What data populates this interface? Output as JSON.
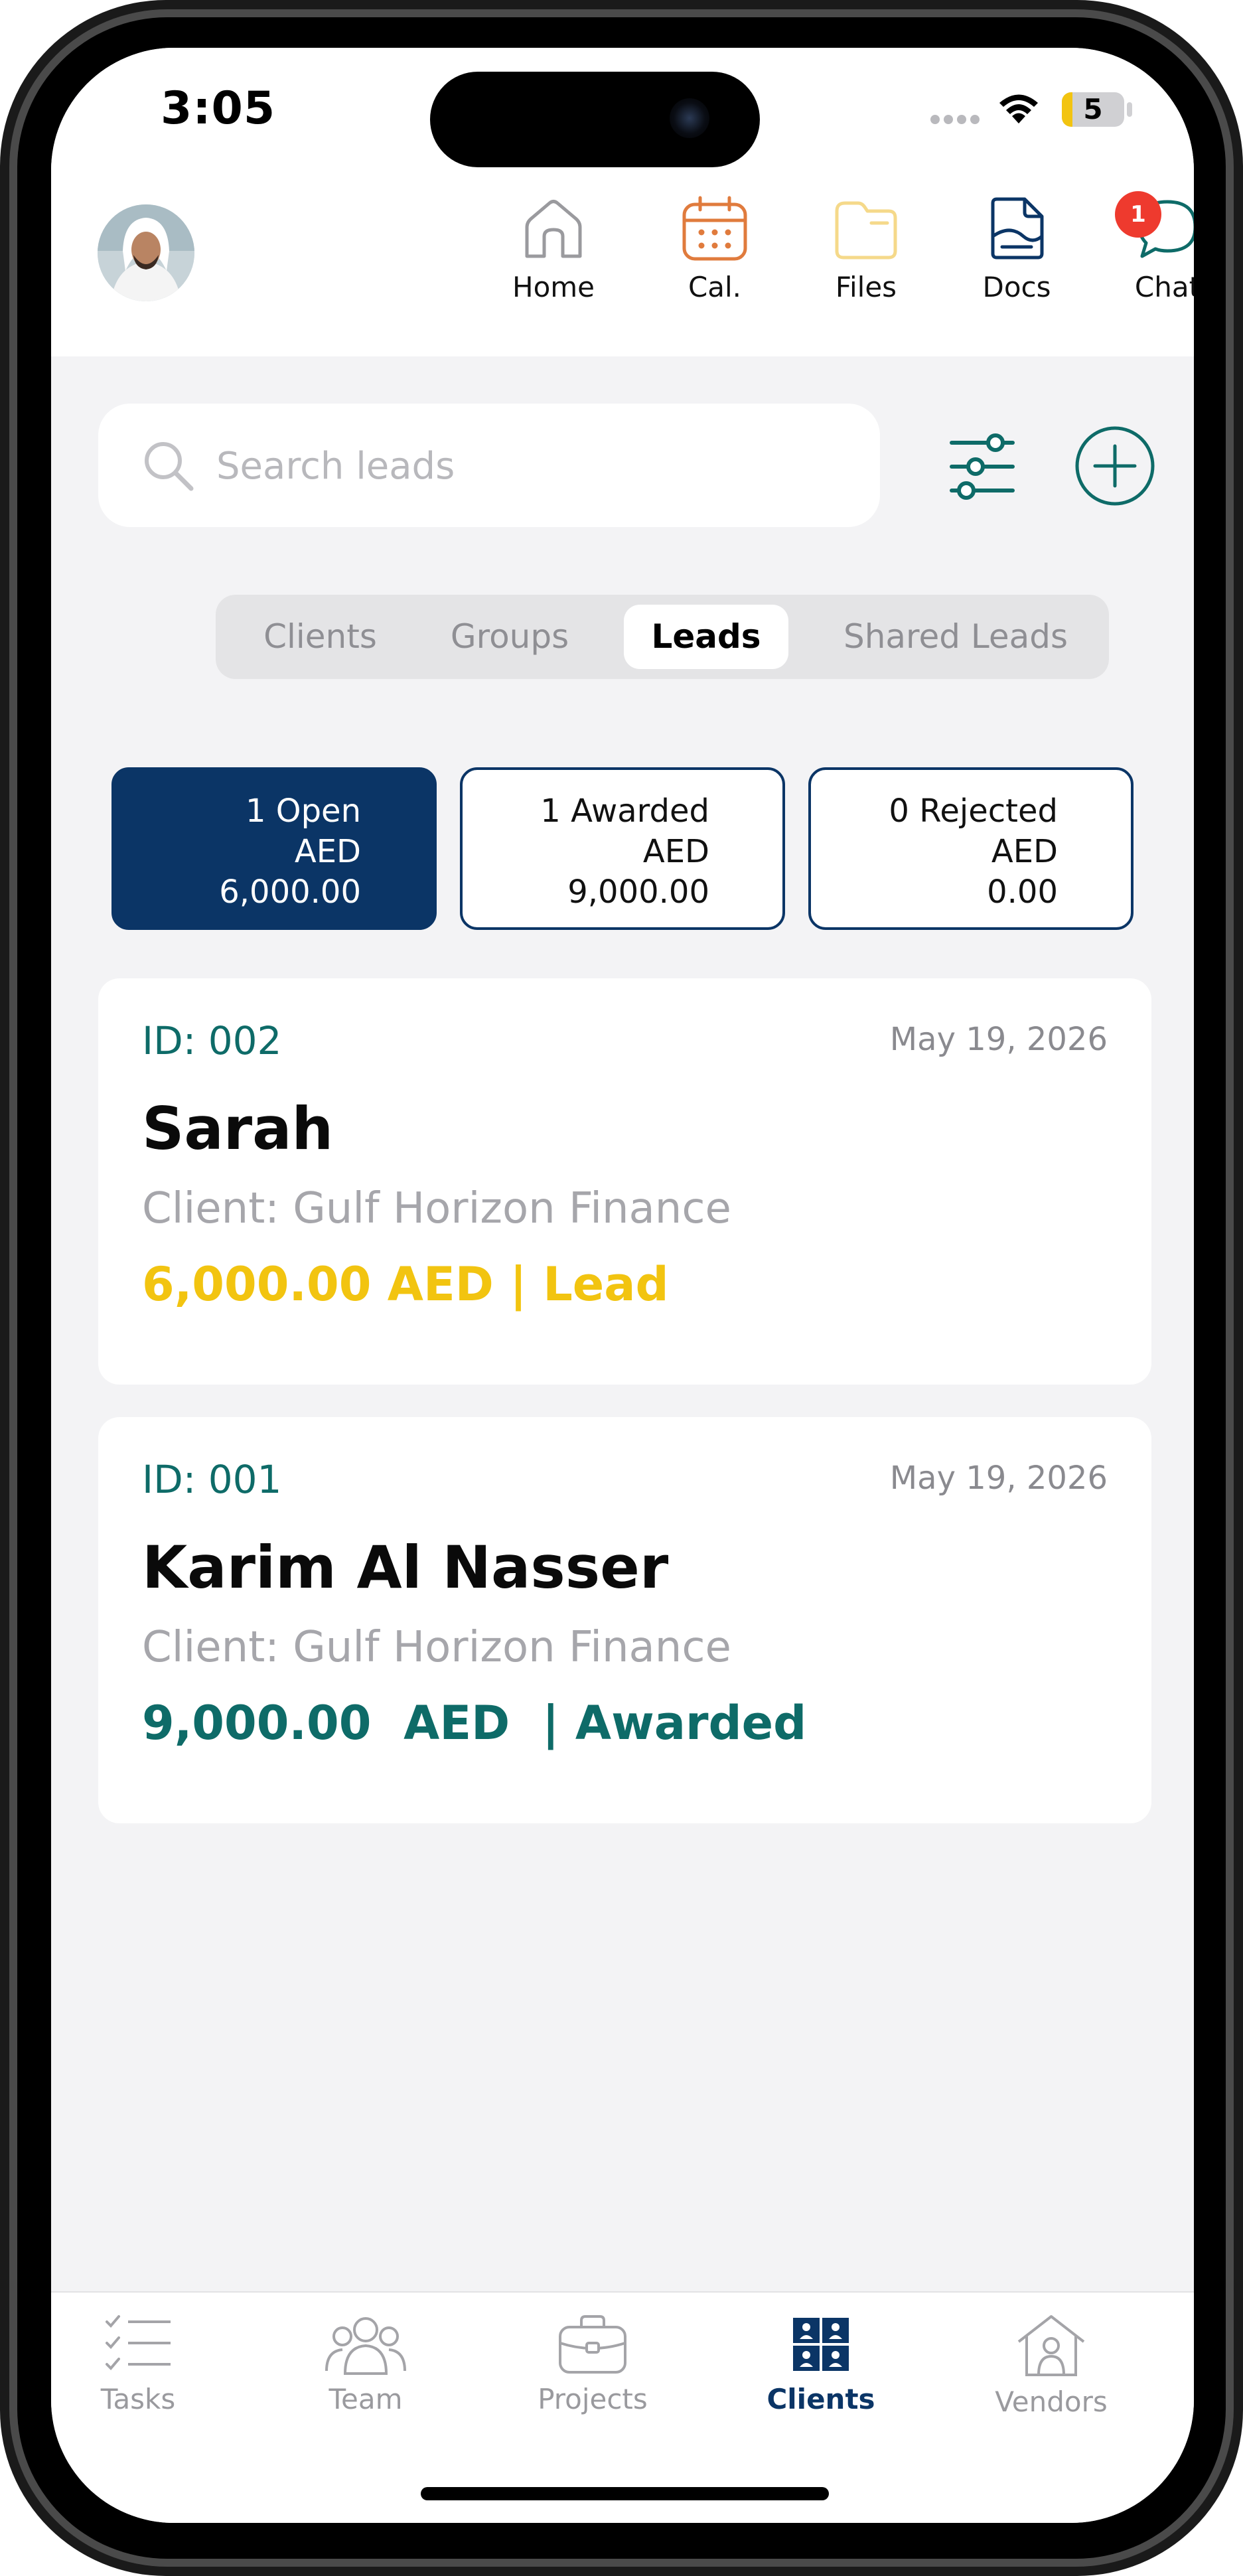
{
  "status_bar": {
    "time": "3:05",
    "battery": "5"
  },
  "header": {
    "nav": [
      {
        "label": "Home",
        "icon": "home-icon"
      },
      {
        "label": "Cal.",
        "icon": "calendar-icon"
      },
      {
        "label": "Files",
        "icon": "folder-icon"
      },
      {
        "label": "Docs",
        "icon": "document-icon"
      },
      {
        "label": "Chat",
        "icon": "chat-icon",
        "badge": "1"
      }
    ]
  },
  "search": {
    "placeholder": "Search leads",
    "value": ""
  },
  "segments": [
    {
      "label": "Clients",
      "active": false
    },
    {
      "label": "Groups",
      "active": false
    },
    {
      "label": "Leads",
      "active": true
    },
    {
      "label": "Shared Leads",
      "active": false
    }
  ],
  "stats": [
    {
      "line1": "1 Open",
      "line2": "AED",
      "line3": "6,000.00",
      "active": true
    },
    {
      "line1": "1 Awarded",
      "line2": "AED",
      "line3": "9,000.00",
      "active": false
    },
    {
      "line1": "0 Rejected",
      "line2": "AED",
      "line3": "0.00",
      "active": false
    }
  ],
  "leads": [
    {
      "id": "ID: 002",
      "date": "May 19, 2026",
      "name": "Sarah",
      "client": "Client: Gulf Horizon Finance",
      "amount": "6,000.00 AED | Lead",
      "color": "#f2c410"
    },
    {
      "id": "ID: 001",
      "date": "May 19, 2026",
      "name": "Karim Al Nasser",
      "client": "Client: Gulf Horizon Finance",
      "amount": "9,000.00  AED  | Awarded",
      "color": "#0e6b68"
    }
  ],
  "tabbar": [
    {
      "label": "Tasks",
      "icon": "tasks-icon",
      "active": false
    },
    {
      "label": "Team",
      "icon": "team-icon",
      "active": false
    },
    {
      "label": "Projects",
      "icon": "briefcase-icon",
      "active": false
    },
    {
      "label": "Clients",
      "icon": "clients-icon",
      "active": true
    },
    {
      "label": "Vendors",
      "icon": "vendors-icon",
      "active": false
    }
  ],
  "colors": {
    "primary": "#0b3566",
    "teal": "#0e6b68",
    "lead_yellow": "#f2c410",
    "background": "#f3f3f5",
    "badge_red": "#ee3a2e"
  }
}
